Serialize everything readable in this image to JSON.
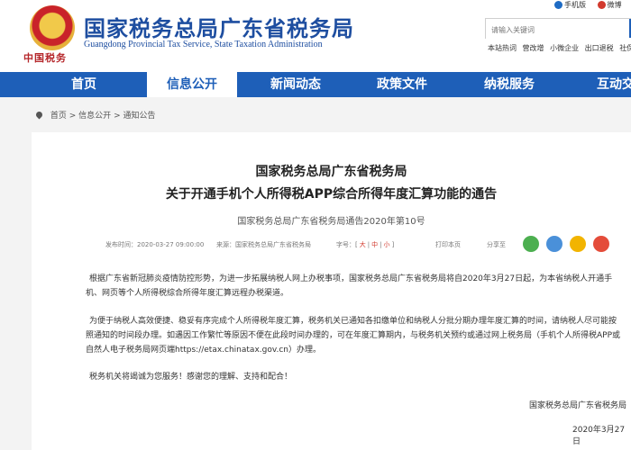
{
  "header": {
    "emblem_text": "中国税务",
    "title": "国家税务总局广东省税务局",
    "subtitle": "Guangdong Provincial Tax Service, State Taxation Administration",
    "top_links": [
      "手机版",
      "微博"
    ],
    "search_placeholder": "请输入关键词",
    "quick_links": [
      "本站热词",
      "营改增",
      "小微企业",
      "出口退税",
      "社保费"
    ]
  },
  "nav": {
    "items": [
      "首页",
      "信息公开",
      "新闻动态",
      "政策文件",
      "纳税服务",
      "互动交流"
    ],
    "active": "信息公开"
  },
  "breadcrumb": [
    "首页",
    "信息公开",
    "通知公告"
  ],
  "article": {
    "title_line1": "国家税务总局广东省税务局",
    "title_line2": "关于开通手机个人所得税APP综合所得年度汇算功能的通告",
    "doc_number": "国家税务总局广东省税务局通告2020年第10号",
    "published": "发布时间：2020-03-27 09:00:00",
    "source": "来源：国家税务总局广东省税务局",
    "font_label": "字号：",
    "font_sizes": [
      "大",
      "中",
      "小"
    ],
    "print": "打印本页",
    "share": "分享至",
    "paragraph1": "根据广东省新冠肺炎疫情防控形势，为进一步拓展纳税人网上办税事项，国家税务总局广东省税务局将自2020年3月27日起，为本省纳税人开通手机、网页等个人所得税综合所得年度汇算远程办税渠道。",
    "paragraph2": "为便于纳税人高效便捷、稳妥有序完成个人所得税年度汇算，税务机关已通知各扣缴单位和纳税人分批分期办理年度汇算的时间，请纳税人尽可能按照通知的时间段办理。如遇因工作繁忙等原因不便在此段时间办理的，可在年度汇算期内，与税务机关预约或通过网上税务局（手机个人所得税APP或自然人电子税务局网页端https://etax.chinatax.gov.cn）办理。",
    "paragraph3": "税务机关将竭诚为您服务！感谢您的理解、支持和配合！",
    "signature": "国家税务总局广东省税务局",
    "date": "2020年3月27日"
  },
  "colors": {
    "brand_blue": "#1e5fb8",
    "accent_red": "#d23a2e",
    "share_wechat": "#4caf50",
    "share_qq": "#4a90d9",
    "share_qzone": "#f2b400",
    "share_weibo": "#e44c3a"
  }
}
